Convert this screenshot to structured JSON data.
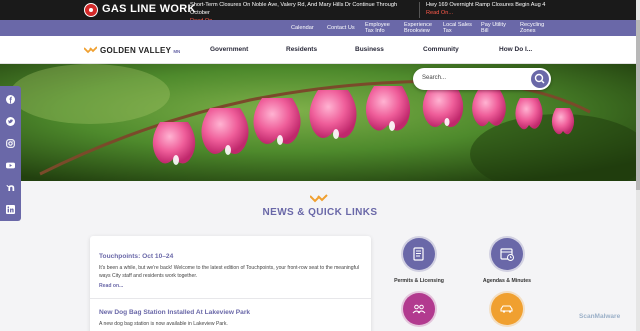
{
  "alert": {
    "title": "GAS LINE WORK",
    "items": [
      {
        "text": "Short-Term Closures On Noble Ave, Valery Rd, And Mary Hills Dr Continue Through October",
        "more": "Read On..."
      },
      {
        "text": "Hwy 169 Overnight Ramp Closures Begin Aug 4",
        "more": "Read On..."
      }
    ]
  },
  "utility": {
    "links": [
      "Calendar",
      "Contact Us",
      "Employee Tax Info",
      "Experience Brookview",
      "Local Sales Tax",
      "Pay Utility Bill",
      "Recycling Zones"
    ]
  },
  "logo": {
    "name": "GOLDEN VALLEY",
    "state": "MN"
  },
  "nav": {
    "items": [
      "Government",
      "Residents",
      "Business",
      "Community",
      "How Do I..."
    ]
  },
  "search": {
    "placeholder": "Search..."
  },
  "social": [
    "facebook-icon",
    "twitter-icon",
    "instagram-icon",
    "youtube-icon",
    "nextdoor-icon",
    "linkedin-icon"
  ],
  "news": {
    "heading": "NEWS & QUICK LINKS",
    "items": [
      {
        "title": "Touchpoints: Oct 10–24",
        "body": "It's been a while, but we're back! Welcome to the latest edition of Touchpoints, your front-row seat to the meaningful ways City staff and residents work together.",
        "more": "Read on..."
      },
      {
        "title": "New Dog Bag Station Installed At Lakeview Park",
        "body": "A new dog bag station is now available in Lakeview Park."
      }
    ]
  },
  "quick_links": [
    {
      "label": "Permits & Licensing",
      "icon": "document-icon",
      "color": "#6a68a8"
    },
    {
      "label": "Agendas & Minutes",
      "icon": "calendar-clock-icon",
      "color": "#6a68a8"
    },
    {
      "label": "",
      "icon": "people-icon",
      "color": "#b23a8f"
    },
    {
      "label": "",
      "icon": "car-icon",
      "color": "#f0a030"
    }
  ],
  "watermark": "ScanMalware"
}
